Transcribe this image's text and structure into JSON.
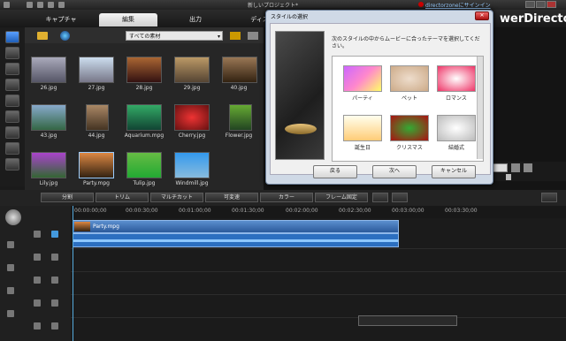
{
  "window": {
    "title": "新しいプロジェクト*",
    "signin": "directorzoneにサインイン"
  },
  "tabs": [
    {
      "label": "キャプチャ"
    },
    {
      "label": "編集"
    },
    {
      "label": "出力"
    },
    {
      "label": "ディスク"
    }
  ],
  "brand": "werDirector",
  "library": {
    "filter": "すべての素材",
    "items": [
      {
        "label": "26.jpg"
      },
      {
        "label": "27.jpg"
      },
      {
        "label": "28.jpg"
      },
      {
        "label": "29.jpg"
      },
      {
        "label": "40.jpg"
      },
      {
        "label": "43.jpg"
      },
      {
        "label": "44.jpg"
      },
      {
        "label": "Aquarium.mpg"
      },
      {
        "label": "Cherry.jpg"
      },
      {
        "label": "Flower.jpg"
      },
      {
        "label": "Lily.jpg"
      },
      {
        "label": "Party.mpg"
      },
      {
        "label": "Tulip.jpg"
      },
      {
        "label": "Windmill.jpg"
      }
    ]
  },
  "dialog": {
    "title": "スタイルの選択",
    "description": "次のスタイルの中からムービーに合ったテーマを選択してください。",
    "styles": [
      {
        "label": "パーティ"
      },
      {
        "label": "ペット"
      },
      {
        "label": "ロマンス"
      },
      {
        "label": "誕生日"
      },
      {
        "label": "クリスマス"
      },
      {
        "label": "結婚式"
      }
    ],
    "buttons": {
      "back": "戻る",
      "next": "次へ",
      "cancel": "キャンセル"
    }
  },
  "timeline_toolbar": [
    "分割",
    "トリム",
    "マルチカット",
    "可変速",
    "カラー",
    "フレーム固定"
  ],
  "ruler": [
    "00:00:00;00",
    "00:00:30;00",
    "00:01:00;00",
    "00:01:30;00",
    "00:02:00;00",
    "00:02:30;00",
    "00:03:00;00",
    "00:03:30;00"
  ],
  "clip": {
    "label": "Party.mpg"
  },
  "colors": {
    "accent": "#2b5a9b",
    "dialog_bg": "#cfd9e6"
  }
}
